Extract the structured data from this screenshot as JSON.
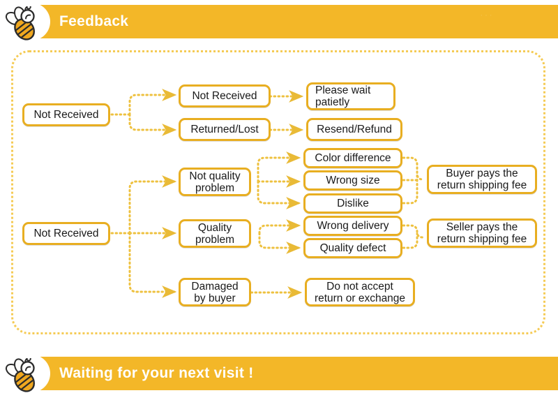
{
  "colors": {
    "banner_bg": "#f3b728",
    "node_border": "#e8ae21",
    "connector": "#eec13f",
    "panel_border": "#f5cb55",
    "page_bg": "#ffffff",
    "banner_text": "#ffffff",
    "node_text": "#1a1a1a"
  },
  "header": {
    "title": "Feedback",
    "icon": "bee-icon",
    "watermark": "·  ·  ·"
  },
  "footer": {
    "title": "Waiting for your next visit !",
    "icon": "bee-icon"
  },
  "diagram": {
    "nodes": [
      {
        "id": "root-1",
        "text": "Not Received"
      },
      {
        "id": "not-received-1",
        "text": "Not Received"
      },
      {
        "id": "returned-lost",
        "text": "Returned/Lost"
      },
      {
        "id": "please-wait",
        "text": "Please wait\npatietly"
      },
      {
        "id": "resend-refund",
        "text": "Resend/Refund"
      },
      {
        "id": "root-2",
        "text": "Not Received"
      },
      {
        "id": "not-quality-problem",
        "text": "Not quality\nproblem"
      },
      {
        "id": "quality-problem",
        "text": "Quality\nproblem"
      },
      {
        "id": "color-difference",
        "text": "Color difference"
      },
      {
        "id": "wrong-size",
        "text": "Wrong size"
      },
      {
        "id": "dislike",
        "text": "Dislike"
      },
      {
        "id": "wrong-delivery",
        "text": "Wrong delivery"
      },
      {
        "id": "quality-defect",
        "text": "Quality defect"
      },
      {
        "id": "buyer-pays",
        "text": "Buyer pays the\nreturn shipping fee"
      },
      {
        "id": "seller-pays",
        "text": "Seller pays the\nreturn shipping fee"
      },
      {
        "id": "damaged-by-buyer",
        "text": "Damaged\nby buyer"
      },
      {
        "id": "do-not-accept",
        "text": "Do not accept\nreturn or exchange"
      }
    ],
    "edges": [
      {
        "from": "root-1",
        "to": "not-received-1"
      },
      {
        "from": "root-1",
        "to": "returned-lost"
      },
      {
        "from": "not-received-1",
        "to": "please-wait"
      },
      {
        "from": "returned-lost",
        "to": "resend-refund"
      },
      {
        "from": "root-2",
        "to": "not-quality-problem"
      },
      {
        "from": "root-2",
        "to": "quality-problem"
      },
      {
        "from": "root-2",
        "to": "damaged-by-buyer"
      },
      {
        "from": "not-quality-problem",
        "to": "color-difference"
      },
      {
        "from": "not-quality-problem",
        "to": "wrong-size"
      },
      {
        "from": "not-quality-problem",
        "to": "dislike"
      },
      {
        "from": "quality-problem",
        "to": "wrong-delivery"
      },
      {
        "from": "quality-problem",
        "to": "quality-defect"
      },
      {
        "from": "color-difference",
        "to": "buyer-pays"
      },
      {
        "from": "wrong-size",
        "to": "buyer-pays"
      },
      {
        "from": "dislike",
        "to": "buyer-pays"
      },
      {
        "from": "wrong-delivery",
        "to": "seller-pays"
      },
      {
        "from": "quality-defect",
        "to": "seller-pays"
      },
      {
        "from": "damaged-by-buyer",
        "to": "do-not-accept"
      }
    ]
  }
}
